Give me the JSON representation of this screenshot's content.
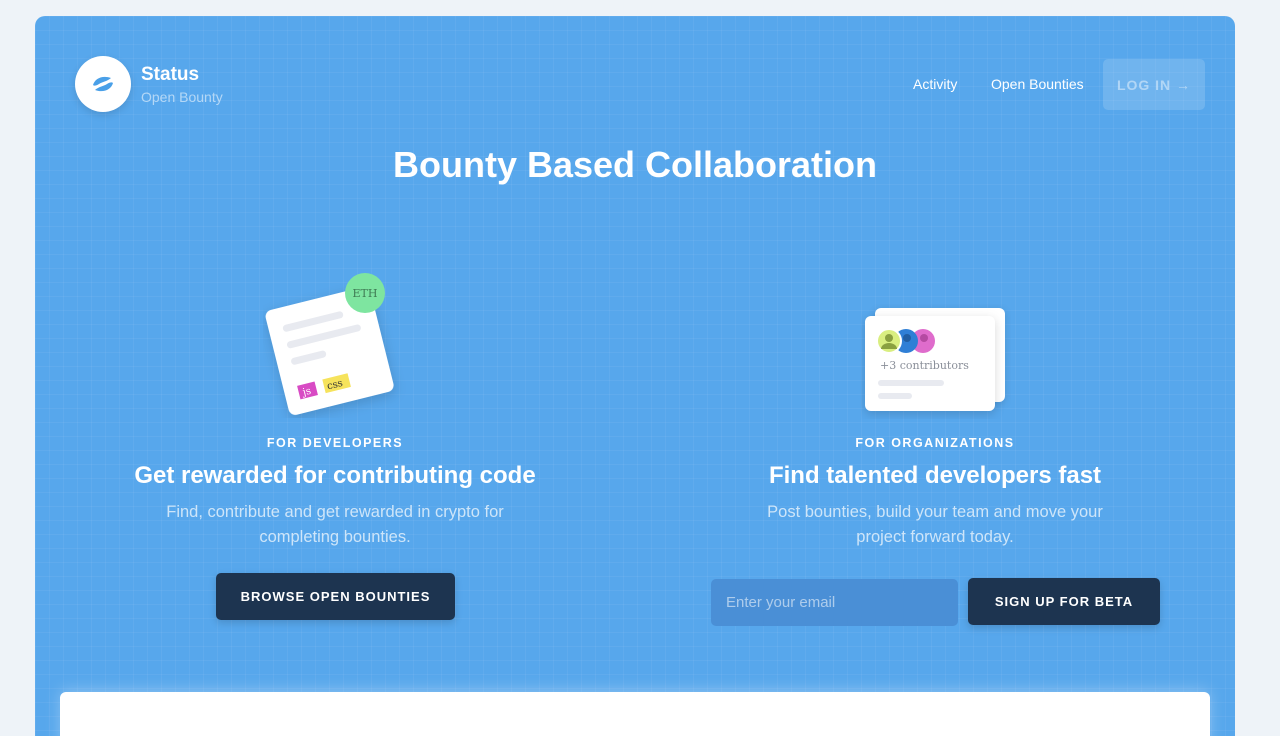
{
  "brand": {
    "name": "Status",
    "subtitle": "Open Bounty"
  },
  "nav": {
    "activity": "Activity",
    "open_bounties": "Open Bounties",
    "login": "LOG IN →"
  },
  "headline": "Bounty Based Collaboration",
  "developers": {
    "eyebrow": "FOR DEVELOPERS",
    "title": "Get rewarded for contributing code",
    "description": "Find, contribute and get rewarded in crypto for completing bounties.",
    "button": "BROWSE OPEN BOUNTIES",
    "illustration": {
      "badge": "ETH",
      "tags": [
        "js",
        "css"
      ]
    }
  },
  "organizations": {
    "eyebrow": "FOR ORGANIZATIONS",
    "title": "Find talented developers fast",
    "description": "Post bounties, build your team and move your project forward today.",
    "email_placeholder": "Enter your email",
    "button": "SIGN UP FOR BETA",
    "illustration": {
      "contributors": "+3 contributors"
    }
  },
  "colors": {
    "hero_bg": "#57a7ec",
    "dark_button": "#1d3450",
    "eth_badge": "#7ee5a0"
  },
  "icons": {
    "logo": "status-logo-icon",
    "arrow": "arrow-right-icon"
  }
}
